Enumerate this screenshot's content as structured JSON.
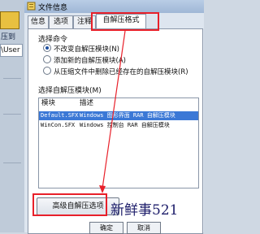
{
  "background_window": {
    "toolbar_label": "压到",
    "path_text": "\\User"
  },
  "dialog": {
    "title": "文件信息",
    "tabs": [
      {
        "label": "信息"
      },
      {
        "label": "选项"
      },
      {
        "label": "注释"
      },
      {
        "label": "自解压格式"
      }
    ],
    "active_tab": "自解压格式",
    "select_command": {
      "heading": "选择命令",
      "options": [
        {
          "label": "不改变自解压模块(N)",
          "selected": true
        },
        {
          "label": "添加新的自解压模块(A)",
          "selected": false
        },
        {
          "label": "从压缩文件中删除已经存在的自解压模块(R)",
          "selected": false
        }
      ]
    },
    "module_list": {
      "heading": "选择自解压模块(M)",
      "columns": [
        "模块",
        "描述"
      ],
      "rows": [
        {
          "module": "Default.SFX",
          "description": "Windows 图形界面 RAR 自解压模块",
          "selected": true
        },
        {
          "module": "WinCon.SFX",
          "description": "Windows 控制台 RAR 自解压模块",
          "selected": false
        }
      ]
    },
    "advanced_button": "高级自解压选项",
    "bottom_buttons": [
      "确定",
      "取消"
    ]
  },
  "annotation": {
    "watermark": "新鲜事521",
    "highlight_color": "#e8202a"
  }
}
